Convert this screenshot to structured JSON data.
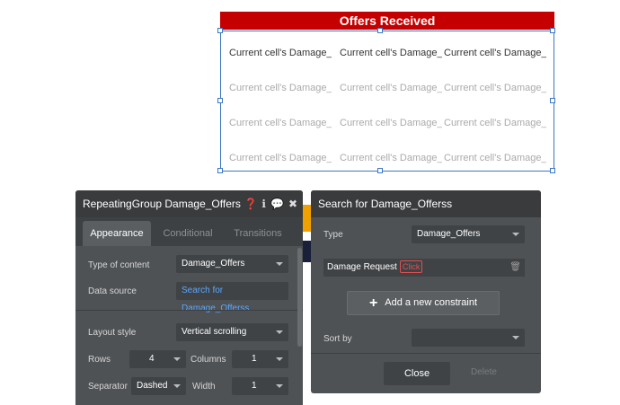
{
  "offers": {
    "title": "Offers Received",
    "cells": [
      [
        "Current cell's Damage_...",
        "Current cell's Damage_...",
        "Current cell's Damage_..."
      ],
      [
        "Current cell's Damage_...",
        "Current cell's Damage_...",
        "Current cell's Damage_..."
      ],
      [
        "Current cell's Damage_...",
        "Current cell's Damage_...",
        "Current cell's Damage_..."
      ],
      [
        "Current cell's Damage_...",
        "Current cell's Damage_...",
        "Current cell's Damage_..."
      ]
    ]
  },
  "property_panel": {
    "title": "RepeatingGroup Damage_Offers",
    "icons": [
      "help-icon",
      "info-icon",
      "comment-icon",
      "close-icon"
    ],
    "tabs": [
      "Appearance",
      "Conditional",
      "Transitions"
    ],
    "type_of_content_label": "Type of content",
    "type_of_content_value": "Damage_Offers",
    "data_source_label": "Data source",
    "data_source_value": "Search for Damage_Offerss",
    "layout_style_label": "Layout style",
    "layout_style_value": "Vertical scrolling",
    "rows_label": "Rows",
    "rows_value": "4",
    "columns_label": "Columns",
    "columns_value": "1",
    "separator_label": "Separator",
    "separator_value": "Dashed",
    "width_label": "Width",
    "width_value": "1"
  },
  "search_panel": {
    "title": "Search for Damage_Offerss",
    "type_label": "Type",
    "type_value": "Damage_Offers",
    "constraint_field": "Damage Request",
    "constraint_tag": "Click",
    "add_constraint_label": "Add a new constraint",
    "sort_by_label": "Sort by",
    "sort_by_value": "",
    "close_label": "Close",
    "delete_label": "Delete"
  },
  "colors": {
    "header_red": "#c40000",
    "selection_blue": "#3b77c4",
    "panel_bg": "#4f5255",
    "link_blue": "#5aa7ff"
  }
}
